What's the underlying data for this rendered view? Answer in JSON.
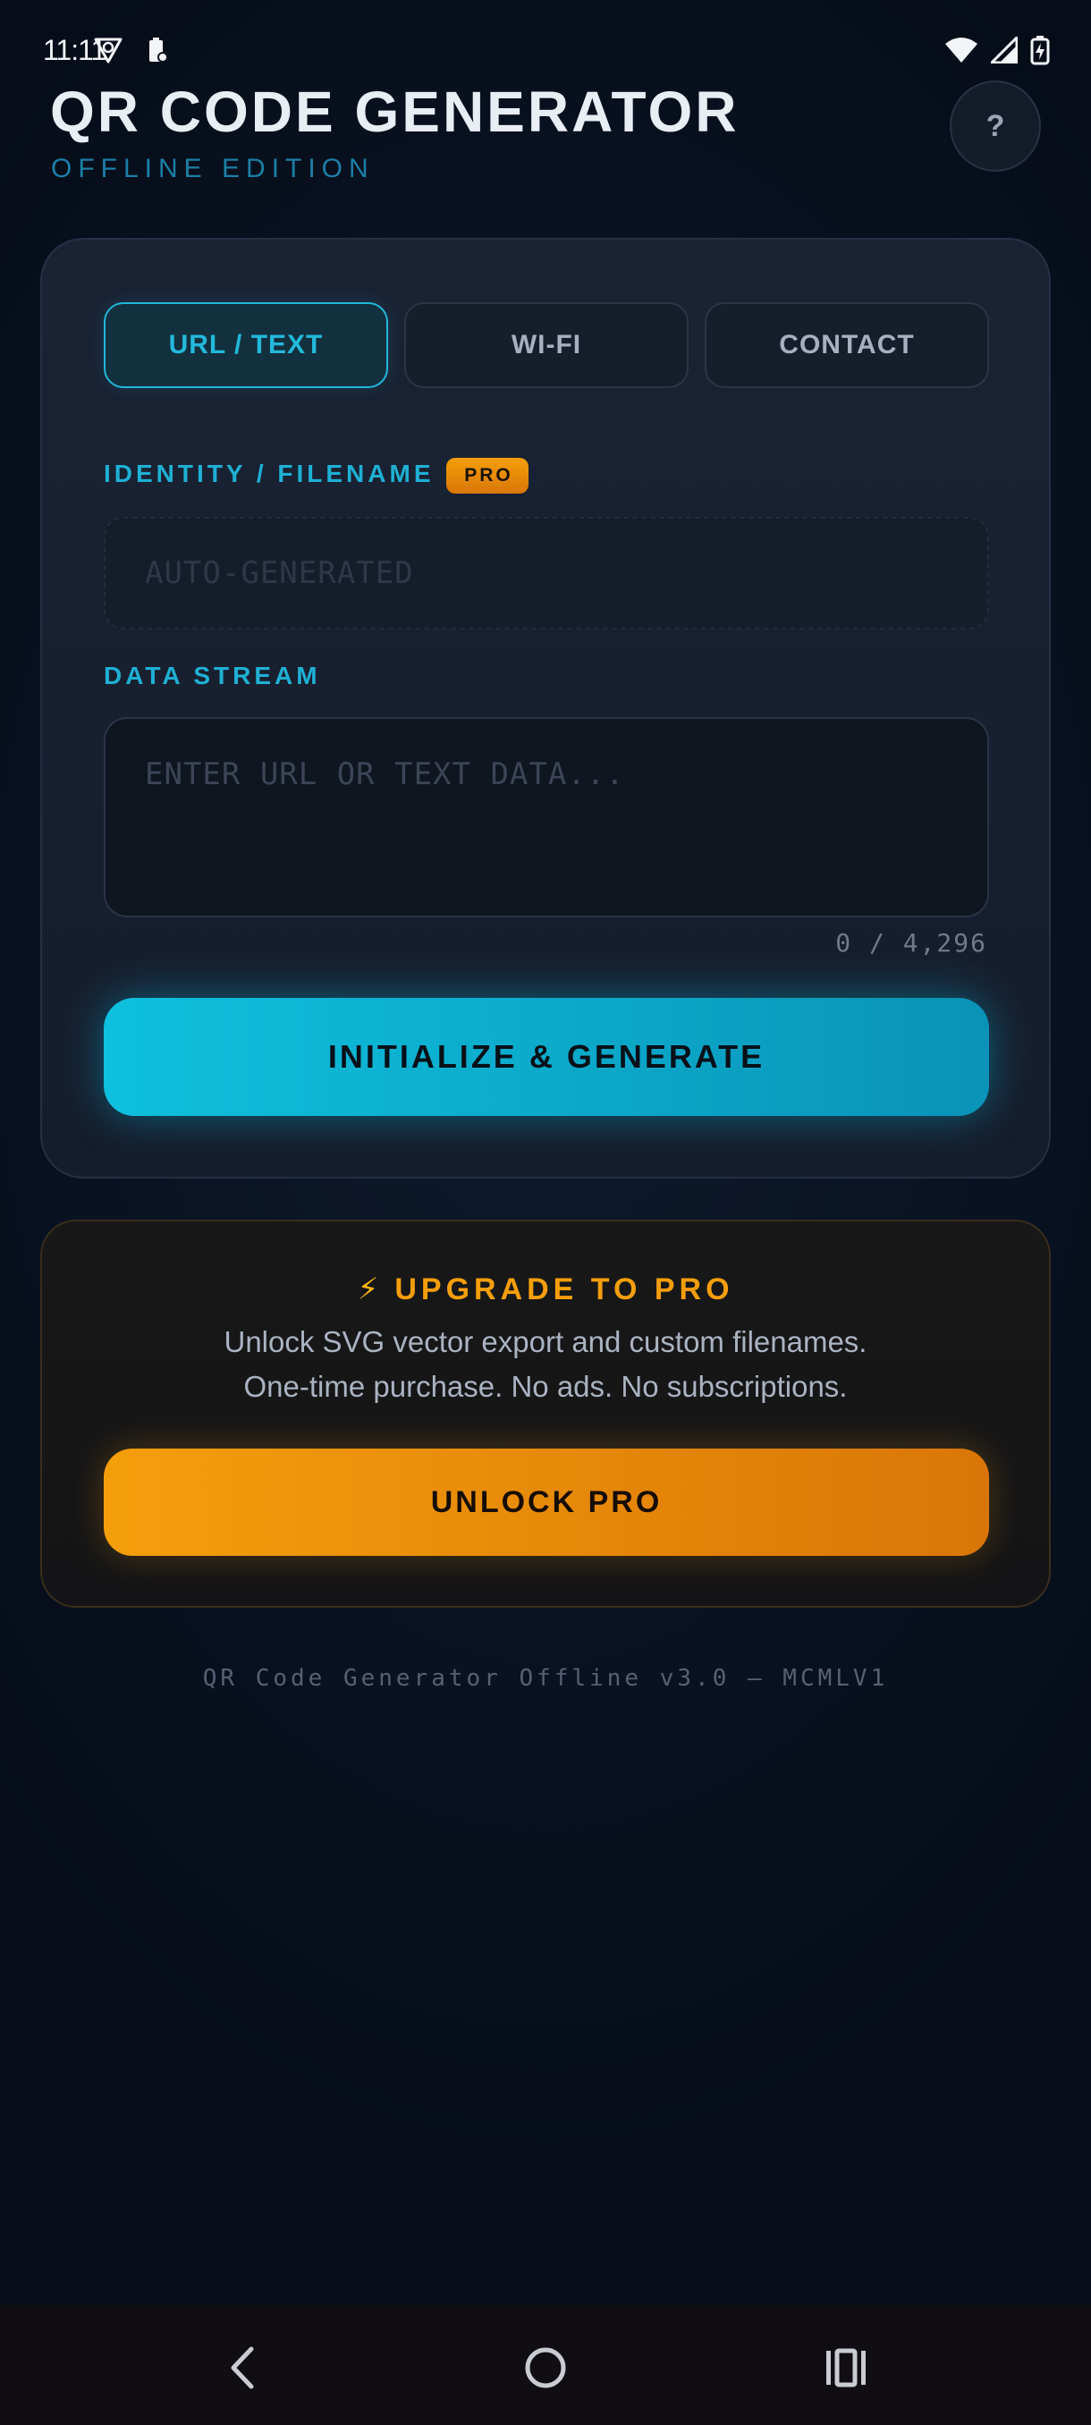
{
  "status_bar": {
    "time": "11:11",
    "left_icons": [
      "vpn-shield-icon",
      "battery-saver-icon"
    ],
    "right_icons": [
      "wifi-icon",
      "cell-signal-icon",
      "battery-charging-icon"
    ]
  },
  "header": {
    "title": "QR CODE GENERATOR",
    "subtitle": "OFFLINE EDITION",
    "help_label": "?"
  },
  "tabs": [
    {
      "label": "URL / TEXT",
      "active": true
    },
    {
      "label": "WI-FI",
      "active": false
    },
    {
      "label": "CONTACT",
      "active": false
    }
  ],
  "form": {
    "identity_label": "IDENTITY / FILENAME",
    "pro_badge": "PRO",
    "identity_placeholder": "AUTO-GENERATED",
    "data_label": "DATA STREAM",
    "data_placeholder": "ENTER URL OR TEXT DATA...",
    "char_count": "0 / 4,296",
    "generate_label": "INITIALIZE & GENERATE"
  },
  "upgrade": {
    "icon": "lightning-icon",
    "title": "UPGRADE TO PRO",
    "line1": "Unlock SVG vector export and custom filenames.",
    "line2": "One-time purchase. No ads. No subscriptions.",
    "button_label": "UNLOCK PRO"
  },
  "footer": {
    "text": "QR Code Generator Offline v3.0 — MCMLV1"
  },
  "nav": {
    "back": "back-icon",
    "home": "home-icon",
    "recents": "recents-icon"
  },
  "colors": {
    "accent_cyan": "#0ec1de",
    "accent_orange": "#f59e0b",
    "background": "#0a1424"
  }
}
